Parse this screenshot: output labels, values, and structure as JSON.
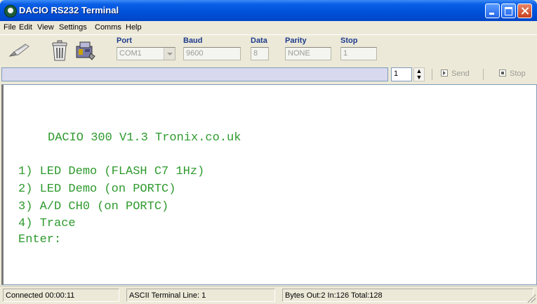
{
  "window": {
    "title": "DACIO RS232 Terminal"
  },
  "menu": [
    "File",
    "Edit",
    "View",
    "Settings",
    "Comms",
    "Help"
  ],
  "toolbar": {
    "icons": [
      "connect-pen-icon",
      "trash-icon",
      "chip-icon"
    ],
    "fields": {
      "port": {
        "label": "Port",
        "value": "COM1"
      },
      "baud": {
        "label": "Baud",
        "value": "9600"
      },
      "data": {
        "label": "Data",
        "value": "8"
      },
      "parity": {
        "label": "Parity",
        "value": "NONE"
      },
      "stop": {
        "label": "Stop",
        "value": "1"
      }
    }
  },
  "send_bar": {
    "input_value": "",
    "repeat_count": "1",
    "send_label": "Send",
    "stop_label": "Stop"
  },
  "terminal": {
    "text_color": "#2e9a2e",
    "lines": [
      "DACIO 300 V1.3 Tronix.co.uk",
      "1) LED Demo (FLASH C7 1Hz)",
      "2) LED Demo (on PORTC)",
      "3) A/D CH0 (on PORTC)",
      "4) Trace",
      "Enter:"
    ]
  },
  "status": {
    "connected": "Connected 00:00:11",
    "mode": "ASCII Terminal Line: 1",
    "bytes": "Bytes Out:2 In:126 Total:128"
  }
}
